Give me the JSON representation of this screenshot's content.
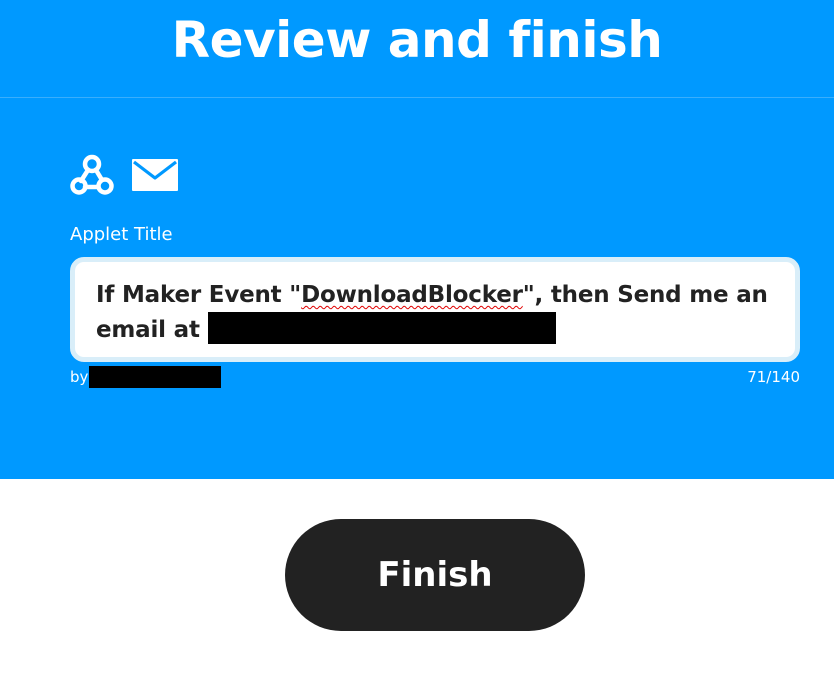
{
  "header": {
    "title": "Review and finish"
  },
  "panel": {
    "icons": [
      {
        "name": "webhooks-icon"
      },
      {
        "name": "email-icon"
      }
    ],
    "applet_title_label": "Applet Title",
    "applet_title": {
      "prefix": "If Maker Event \"",
      "misspelled": "DownloadBlocker",
      "middle": "\", then Send me an email at",
      "redacted_email": true
    },
    "by_label": "by",
    "char_count": "71/140"
  },
  "actions": {
    "finish_label": "Finish"
  },
  "colors": {
    "primary": "#0099ff",
    "button": "#222222",
    "text": "#222222"
  }
}
